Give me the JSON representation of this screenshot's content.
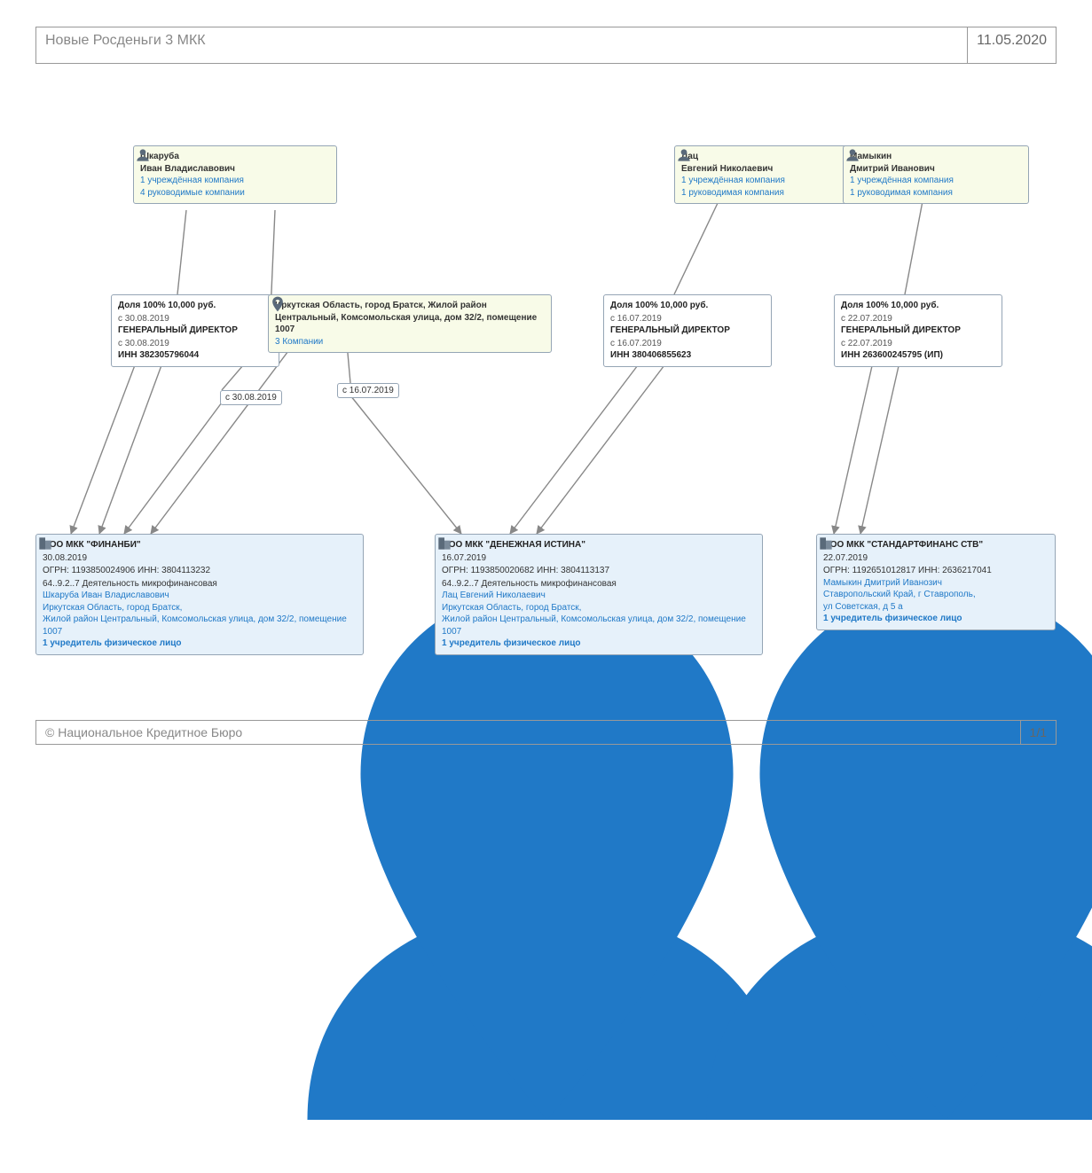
{
  "header": {
    "title": "Новые Росденьги 3 МКК",
    "date": "11.05.2020"
  },
  "footer": {
    "copyright": "© Национальное Кредитное Бюро",
    "page": "1/1"
  },
  "persons": {
    "p1": {
      "surname": "Шкаруба",
      "given": "Иван Владиславович",
      "l1": "1 учреждённая компания",
      "l2": "4 руководимые компании"
    },
    "p2": {
      "surname": "Лац",
      "given": "Евгений Николаевич",
      "l1": "1 учреждённая компания",
      "l2": "1 руководимая компания"
    },
    "p3": {
      "surname": "Мамыкин",
      "given": "Дмитрий Иванович",
      "l1": "1 учреждённая компания",
      "l2": "1 руководимая компания"
    }
  },
  "address": {
    "text": "Иркутская Область, город Братск, Жилой район Центральный, Комсомольская улица, дом 32/2, помещение 1007",
    "link": "3 Компании"
  },
  "shares": {
    "s1": {
      "share": "Доля 100%  10,000 руб.",
      "d1": "с 30.08.2019",
      "pos": "ГЕНЕРАЛЬНЫЙ ДИРЕКТОР",
      "d2": "с 30.08.2019",
      "inn": "ИНН 382305796044"
    },
    "s2": {
      "share": "Доля 100%  10,000 руб.",
      "d1": "с 16.07.2019",
      "pos": "ГЕНЕРАЛЬНЫЙ ДИРЕКТОР",
      "d2": "с 16.07.2019",
      "inn": "ИНН 380406855623"
    },
    "s3": {
      "share": "Доля 100%  10,000 руб.",
      "d1": "с 22.07.2019",
      "pos": "ГЕНЕРАЛЬНЫЙ ДИРЕКТОР",
      "d2": "с 22.07.2019",
      "inn": "ИНН 263600245795 (ИП)"
    }
  },
  "edgeLabels": {
    "e1": "с 30.08.2019",
    "e2": "с 16.07.2019"
  },
  "companies": {
    "c1": {
      "name": "ООО МКК \"ФИНАНБИ\"",
      "date": "30.08.2019",
      "ogrn_inn": "ОГРН: 1193850024906    ИНН: 3804113232",
      "act": "64..9.2..7 Деятельность микрофинансовая",
      "person": "Шкаруба Иван Владиславович",
      "addr1": "Иркутская Область, город Братск,",
      "addr2": "Жилой район Центральный, Комсомольская улица, дом 32/2, помещение 1007",
      "founder": "1 учредитель физическое лицо"
    },
    "c2": {
      "name": "ООО МКК \"ДЕНЕЖНАЯ ИСТИНА\"",
      "date": "16.07.2019",
      "ogrn_inn": "ОГРН: 1193850020682    ИНН: 3804113137",
      "act": "64..9.2..7 Деятельность микрофинансовая",
      "person": "Лац Евгений Николаевич",
      "addr1": "Иркутская Область, город Братск,",
      "addr2": "Жилой район Центральный, Комсомольская улица, дом 32/2, помещение 1007",
      "founder": "1 учредитель физическое лицо"
    },
    "c3": {
      "name": "ООО МКК \"СТАНДАРТФИНАНС СТВ\"",
      "date": "22.07.2019",
      "ogrn_inn": "ОГРН: 1192651012817    ИНН: 2636217041",
      "person": "Мамыкин Дмитрий Иванозич",
      "addr1": "Ставропольский Край, г Ставрополь,",
      "addr2": "ул Советская, д 5 а",
      "founder": "1 учредитель физическое лицо"
    }
  }
}
